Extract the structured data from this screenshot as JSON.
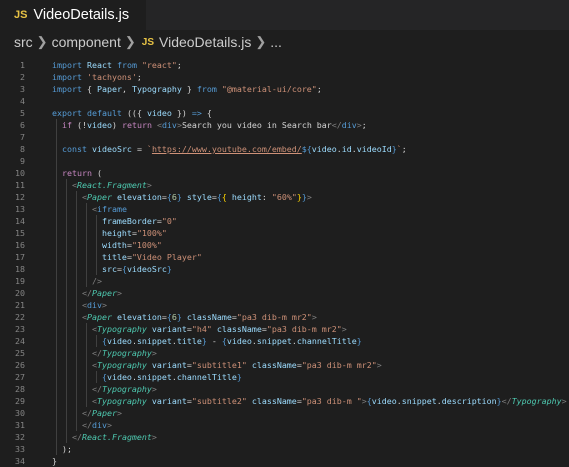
{
  "tab": {
    "badge": "JS",
    "title": "VideoDetails.js"
  },
  "breadcrumb": {
    "items": [
      "src",
      "component",
      "VideoDetails.js",
      "..."
    ],
    "badge": "JS"
  },
  "code": {
    "lines": [
      {
        "n": "1",
        "tokens": [
          [
            "kw",
            "import "
          ],
          [
            "var",
            "React "
          ],
          [
            "kw",
            "from "
          ],
          [
            "str",
            "\"react\""
          ],
          [
            "pun",
            ";"
          ]
        ]
      },
      {
        "n": "2",
        "tokens": [
          [
            "kw",
            "import "
          ],
          [
            "str",
            "'tachyons'"
          ],
          [
            "pun",
            ";"
          ]
        ]
      },
      {
        "n": "3",
        "tokens": [
          [
            "kw",
            "import "
          ],
          [
            "pun",
            "{ "
          ],
          [
            "var",
            "Paper"
          ],
          [
            "pun",
            ", "
          ],
          [
            "var",
            "Typography "
          ],
          [
            "pun",
            "} "
          ],
          [
            "kw",
            "from "
          ],
          [
            "str",
            "\"@material-ui/core\""
          ],
          [
            "pun",
            ";"
          ]
        ]
      },
      {
        "n": "4",
        "tokens": []
      },
      {
        "n": "5",
        "tokens": [
          [
            "kw",
            "export default "
          ],
          [
            "pun",
            "(("
          ],
          [
            "pun",
            "{ "
          ],
          [
            "var",
            "video "
          ],
          [
            "pun",
            "}"
          ],
          [
            "pun",
            ") "
          ],
          [
            "kw",
            "=> "
          ],
          [
            "pun",
            "{"
          ]
        ]
      },
      {
        "n": "6",
        "tokens": [
          [
            "ctl",
            "  if "
          ],
          [
            "pun",
            "(!"
          ],
          [
            "var",
            "video"
          ],
          [
            "pun",
            ") "
          ],
          [
            "ctl",
            "return "
          ],
          [
            "gray",
            "<"
          ],
          [
            "tag",
            "div"
          ],
          [
            "gray",
            ">"
          ],
          [
            "pun",
            "Search you video in Search bar"
          ],
          [
            "gray",
            "</"
          ],
          [
            "tag",
            "div"
          ],
          [
            "gray",
            ">"
          ],
          [
            "pun",
            ";"
          ]
        ]
      },
      {
        "n": "7",
        "tokens": []
      },
      {
        "n": "8",
        "tokens": [
          [
            "kw",
            "  const "
          ],
          [
            "var",
            "videoSrc "
          ],
          [
            "pun",
            "= "
          ],
          [
            "str",
            "`"
          ],
          [
            "str url",
            "https://www.youtube.com/embed/"
          ],
          [
            "kw",
            "${"
          ],
          [
            "var",
            "video"
          ],
          [
            "pun",
            "."
          ],
          [
            "var",
            "id"
          ],
          [
            "pun",
            "."
          ],
          [
            "var",
            "videoId"
          ],
          [
            "kw",
            "}"
          ],
          [
            "str",
            "`"
          ],
          [
            "pun",
            ";"
          ]
        ]
      },
      {
        "n": "9",
        "tokens": []
      },
      {
        "n": "10",
        "tokens": [
          [
            "ctl",
            "  return "
          ],
          [
            "pun",
            "("
          ]
        ]
      },
      {
        "n": "11",
        "tokens": [
          [
            "gray",
            "    <"
          ],
          [
            "cmp ital",
            "React.Fragment"
          ],
          [
            "gray",
            ">"
          ]
        ]
      },
      {
        "n": "12",
        "tokens": [
          [
            "gray",
            "      <"
          ],
          [
            "cmp ital",
            "Paper "
          ],
          [
            "attr",
            "elevation"
          ],
          [
            "pun",
            "="
          ],
          [
            "kw",
            "{"
          ],
          [
            "num",
            "6"
          ],
          [
            "kw",
            "}"
          ],
          [
            "attr",
            " style"
          ],
          [
            "pun",
            "="
          ],
          [
            "kw",
            "{"
          ],
          [
            "brk",
            "{ "
          ],
          [
            "var",
            "height"
          ],
          [
            "pun",
            ": "
          ],
          [
            "str",
            "\"60%\""
          ],
          [
            "brk",
            "}"
          ],
          [
            "kw",
            "}"
          ],
          [
            "gray",
            ">"
          ]
        ]
      },
      {
        "n": "13",
        "tokens": [
          [
            "gray",
            "        <"
          ],
          [
            "tag",
            "iframe"
          ]
        ]
      },
      {
        "n": "14",
        "tokens": [
          [
            "attr",
            "          frameBorder"
          ],
          [
            "pun",
            "="
          ],
          [
            "str",
            "\"0\""
          ]
        ]
      },
      {
        "n": "15",
        "tokens": [
          [
            "attr",
            "          height"
          ],
          [
            "pun",
            "="
          ],
          [
            "str",
            "\"100%\""
          ]
        ]
      },
      {
        "n": "16",
        "tokens": [
          [
            "attr",
            "          width"
          ],
          [
            "pun",
            "="
          ],
          [
            "str",
            "\"100%\""
          ]
        ]
      },
      {
        "n": "17",
        "tokens": [
          [
            "attr",
            "          title"
          ],
          [
            "pun",
            "="
          ],
          [
            "str",
            "\"Video Player\""
          ]
        ]
      },
      {
        "n": "18",
        "tokens": [
          [
            "attr",
            "          src"
          ],
          [
            "pun",
            "="
          ],
          [
            "kw",
            "{"
          ],
          [
            "var",
            "videoSrc"
          ],
          [
            "kw",
            "}"
          ]
        ]
      },
      {
        "n": "19",
        "tokens": [
          [
            "gray",
            "        />"
          ]
        ]
      },
      {
        "n": "20",
        "tokens": [
          [
            "gray",
            "      </"
          ],
          [
            "cmp ital",
            "Paper"
          ],
          [
            "gray",
            ">"
          ]
        ]
      },
      {
        "n": "21",
        "tokens": [
          [
            "gray",
            "      <"
          ],
          [
            "tag",
            "div"
          ],
          [
            "gray",
            ">"
          ]
        ]
      },
      {
        "n": "22",
        "tokens": [
          [
            "gray",
            "      <"
          ],
          [
            "cmp ital",
            "Paper "
          ],
          [
            "attr",
            "elevation"
          ],
          [
            "pun",
            "="
          ],
          [
            "kw",
            "{"
          ],
          [
            "num",
            "6"
          ],
          [
            "kw",
            "}"
          ],
          [
            "attr",
            " className"
          ],
          [
            "pun",
            "="
          ],
          [
            "str",
            "\"pa3 dib-m mr2\""
          ],
          [
            "gray",
            ">"
          ]
        ]
      },
      {
        "n": "23",
        "tokens": [
          [
            "gray",
            "        <"
          ],
          [
            "cmp ital",
            "Typography "
          ],
          [
            "attr",
            "variant"
          ],
          [
            "pun",
            "="
          ],
          [
            "str",
            "\"h4\" "
          ],
          [
            "attr",
            "className"
          ],
          [
            "pun",
            "="
          ],
          [
            "str",
            "\"pa3 dib-m mr2\""
          ],
          [
            "gray",
            ">"
          ]
        ]
      },
      {
        "n": "24",
        "tokens": [
          [
            "kw",
            "          {"
          ],
          [
            "var",
            "video"
          ],
          [
            "pun",
            "."
          ],
          [
            "var",
            "snippet"
          ],
          [
            "pun",
            "."
          ],
          [
            "var",
            "title"
          ],
          [
            "kw",
            "}"
          ],
          [
            "pun",
            " - "
          ],
          [
            "kw",
            "{"
          ],
          [
            "var",
            "video"
          ],
          [
            "pun",
            "."
          ],
          [
            "var",
            "snippet"
          ],
          [
            "pun",
            "."
          ],
          [
            "var",
            "channelTitle"
          ],
          [
            "kw",
            "}"
          ]
        ]
      },
      {
        "n": "25",
        "tokens": [
          [
            "gray",
            "        </"
          ],
          [
            "cmp ital",
            "Typography"
          ],
          [
            "gray",
            ">"
          ]
        ]
      },
      {
        "n": "26",
        "tokens": [
          [
            "gray",
            "        <"
          ],
          [
            "cmp ital",
            "Typography "
          ],
          [
            "attr",
            "variant"
          ],
          [
            "pun",
            "="
          ],
          [
            "str",
            "\"subtitle1\" "
          ],
          [
            "attr",
            "className"
          ],
          [
            "pun",
            "="
          ],
          [
            "str",
            "\"pa3 dib-m mr2\""
          ],
          [
            "gray",
            ">"
          ]
        ]
      },
      {
        "n": "27",
        "tokens": [
          [
            "kw",
            "          {"
          ],
          [
            "var",
            "video"
          ],
          [
            "pun",
            "."
          ],
          [
            "var",
            "snippet"
          ],
          [
            "pun",
            "."
          ],
          [
            "var",
            "channelTitle"
          ],
          [
            "kw",
            "}"
          ]
        ]
      },
      {
        "n": "28",
        "tokens": [
          [
            "gray",
            "        </"
          ],
          [
            "cmp ital",
            "Typography"
          ],
          [
            "gray",
            ">"
          ]
        ]
      },
      {
        "n": "29",
        "tokens": [
          [
            "gray",
            "        <"
          ],
          [
            "cmp ital",
            "Typography "
          ],
          [
            "attr",
            "variant"
          ],
          [
            "pun",
            "="
          ],
          [
            "str",
            "\"subtitle2\" "
          ],
          [
            "attr",
            "className"
          ],
          [
            "pun",
            "="
          ],
          [
            "str",
            "\"pa3 dib-m \""
          ],
          [
            "gray",
            ">"
          ],
          [
            "kw",
            "{"
          ],
          [
            "var",
            "video"
          ],
          [
            "pun",
            "."
          ],
          [
            "var",
            "snippet"
          ],
          [
            "pun",
            "."
          ],
          [
            "var",
            "description"
          ],
          [
            "kw",
            "}"
          ],
          [
            "gray",
            "</"
          ],
          [
            "cmp ital",
            "Typography"
          ],
          [
            "gray",
            ">"
          ]
        ]
      },
      {
        "n": "30",
        "tokens": [
          [
            "gray",
            "      </"
          ],
          [
            "cmp ital",
            "Paper"
          ],
          [
            "gray",
            ">"
          ]
        ]
      },
      {
        "n": "31",
        "tokens": [
          [
            "gray",
            "      </"
          ],
          [
            "tag",
            "div"
          ],
          [
            "gray",
            ">"
          ]
        ]
      },
      {
        "n": "32",
        "tokens": [
          [
            "gray",
            "    </"
          ],
          [
            "cmp ital",
            "React.Fragment"
          ],
          [
            "gray",
            ">"
          ]
        ]
      },
      {
        "n": "33",
        "tokens": [
          [
            "pun",
            "  );"
          ]
        ]
      },
      {
        "n": "34",
        "tokens": [
          [
            "pun",
            "}"
          ]
        ]
      }
    ]
  },
  "colors": {
    "background": "#1e1e1e",
    "tabbar": "#252526",
    "js_badge": "#e8c345"
  }
}
